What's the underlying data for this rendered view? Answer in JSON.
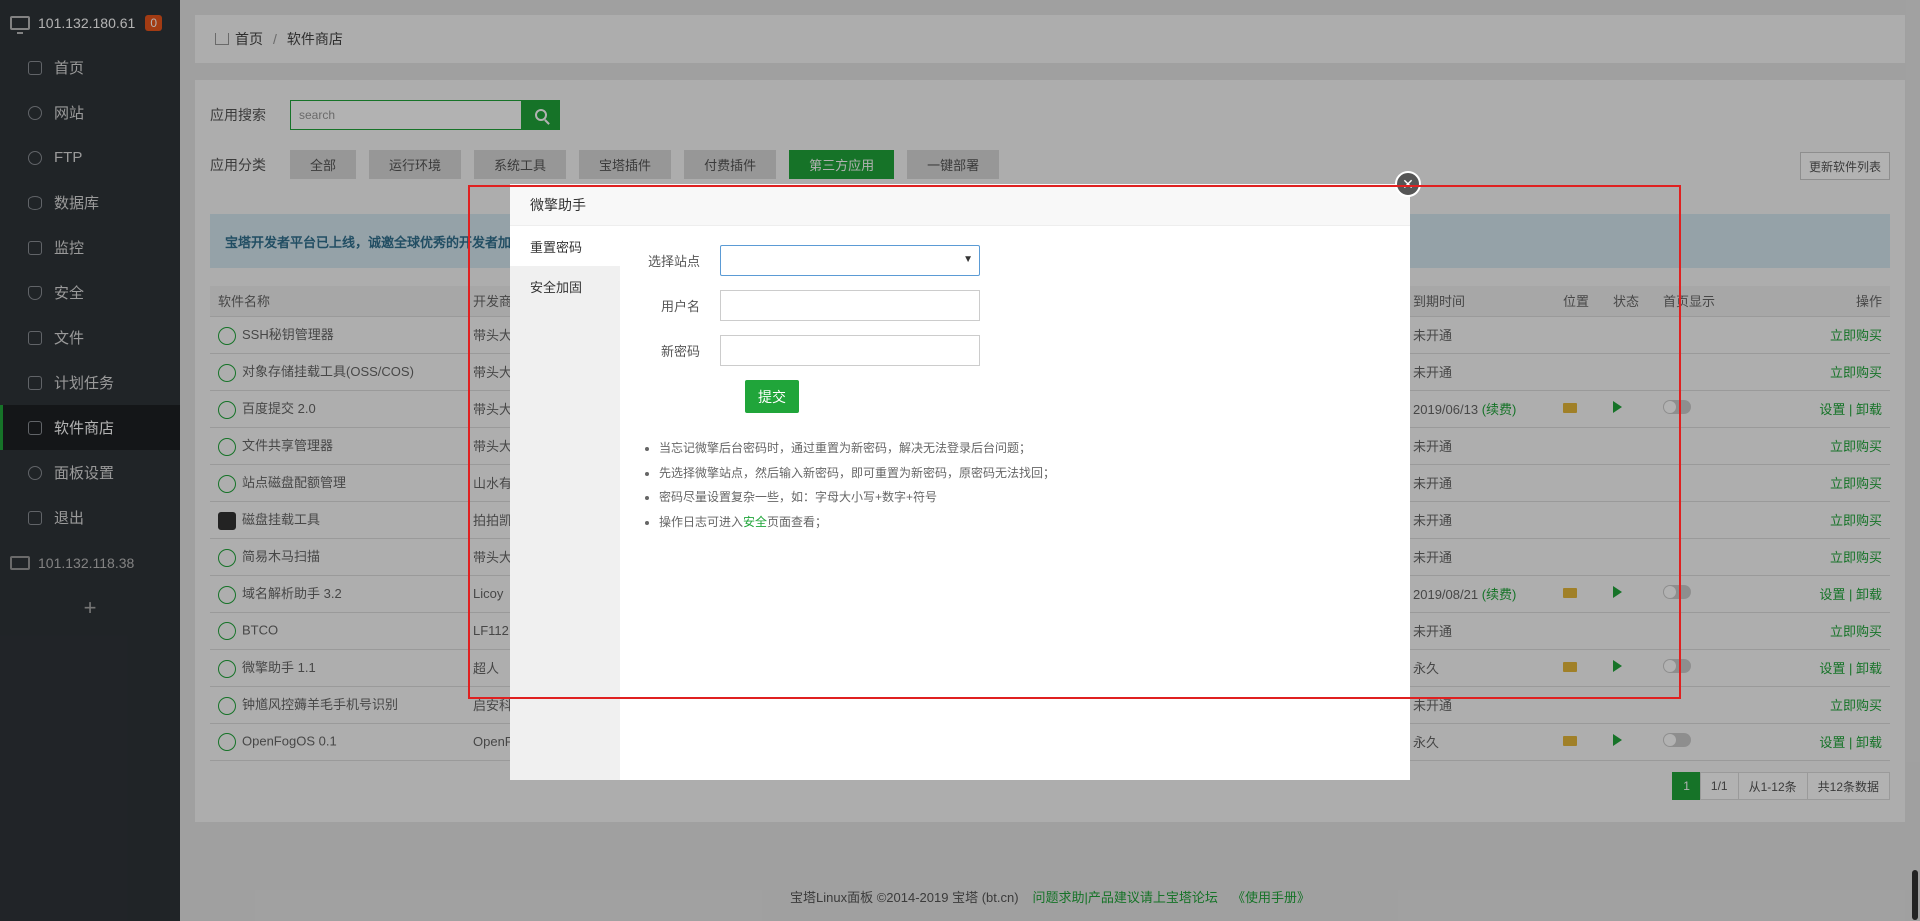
{
  "sidebar": {
    "server_ip": "101.132.180.61",
    "server_badge": "0",
    "items": [
      {
        "label": "首页",
        "icon": "home-icon"
      },
      {
        "label": "网站",
        "icon": "globe-icon"
      },
      {
        "label": "FTP",
        "icon": "ftp-icon"
      },
      {
        "label": "数据库",
        "icon": "database-icon"
      },
      {
        "label": "监控",
        "icon": "monitor-icon"
      },
      {
        "label": "安全",
        "icon": "shield-icon"
      },
      {
        "label": "文件",
        "icon": "folder-icon"
      },
      {
        "label": "计划任务",
        "icon": "calendar-icon"
      },
      {
        "label": "软件商店",
        "icon": "grid-icon"
      },
      {
        "label": "面板设置",
        "icon": "gear-icon"
      },
      {
        "label": "退出",
        "icon": "logout-icon"
      }
    ],
    "server2_ip": "101.132.118.38",
    "add_label": "+"
  },
  "breadcrumb": {
    "home": "首页",
    "sep": "/",
    "current": "软件商店"
  },
  "search": {
    "label": "应用搜索",
    "placeholder": "search"
  },
  "category": {
    "label": "应用分类",
    "items": [
      "全部",
      "运行环境",
      "系统工具",
      "宝塔插件",
      "付费插件",
      "第三方应用",
      "一键部署"
    ],
    "active": "第三方应用"
  },
  "refresh_label": "更新软件列表",
  "notice": "宝塔开发者平台已上线，诚邀全球优秀的开发者加入，",
  "table": {
    "headers": [
      "软件名称",
      "开发商",
      "到期时间",
      "位置",
      "状态",
      "首页显示",
      "操作"
    ],
    "rows": [
      {
        "name": "SSH秘钥管理器",
        "dev": "带头大",
        "expire": "未开通",
        "op": "立即购买"
      },
      {
        "name": "对象存储挂载工具(OSS/COS)",
        "dev": "带头大",
        "expire": "未开通",
        "op": "立即购买"
      },
      {
        "name": "百度提交 2.0",
        "dev": "带头大",
        "expire": "2019/06/13",
        "renew": "(续费)",
        "op": "设置 | 卸载"
      },
      {
        "name": "文件共享管理器",
        "dev": "带头大",
        "expire": "未开通",
        "op": "立即购买"
      },
      {
        "name": "站点磁盘配额管理",
        "dev": "山水有",
        "expire": "未开通",
        "op": "立即购买"
      },
      {
        "name": "磁盘挂载工具",
        "dev": "拍拍凯",
        "expire": "未开通",
        "op": "立即购买"
      },
      {
        "name": "简易木马扫描",
        "dev": "带头大",
        "expire": "未开通",
        "op": "立即购买"
      },
      {
        "name": "域名解析助手 3.2",
        "dev": "Licoy",
        "expire": "2019/08/21",
        "renew": "(续费)",
        "op": "设置 | 卸载"
      },
      {
        "name": "BTCO",
        "dev": "LF112",
        "expire": "未开通",
        "op": "立即购买"
      },
      {
        "name": "微擎助手 1.1",
        "dev": "超人",
        "expire": "永久",
        "op": "设置 | 卸载"
      },
      {
        "name": "钟馗风控薅羊毛手机号识别",
        "dev": "启安科",
        "expire": "未开通",
        "op": "立即购买"
      },
      {
        "name": "OpenFogOS 0.1",
        "dev": "OpenF",
        "expire": "永久",
        "op": "设置 | 卸载"
      }
    ]
  },
  "pager": {
    "current": "1",
    "pages": "1/1",
    "range": "从1-12条",
    "total": "共12条数据"
  },
  "footer": {
    "copyright": "宝塔Linux面板 ©2014-2019 宝塔 (bt.cn)",
    "help": "问题求助|产品建议请上宝塔论坛",
    "manual": "《使用手册》"
  },
  "modal": {
    "title": "微擎助手",
    "tabs": [
      "重置密码",
      "安全加固"
    ],
    "select_site_label": "选择站点",
    "username_label": "用户名",
    "password_label": "新密码",
    "submit_label": "提交",
    "tips": [
      "当忘记微擎后台密码时，通过重置为新密码，解决无法登录后台问题；",
      "先选择微擎站点，然后输入新密码，即可重置为新密码，原密码无法找回；",
      "密码尽量设置复杂一些，如：字母大小写+数字+符号"
    ],
    "tip4_prefix": "操作日志可进入",
    "tip4_link": "安全",
    "tip4_suffix": "页面查看；"
  },
  "colors": {
    "accent": "#20a53a",
    "sidebar_bg": "#2f3439",
    "annotation": "#e02020"
  }
}
